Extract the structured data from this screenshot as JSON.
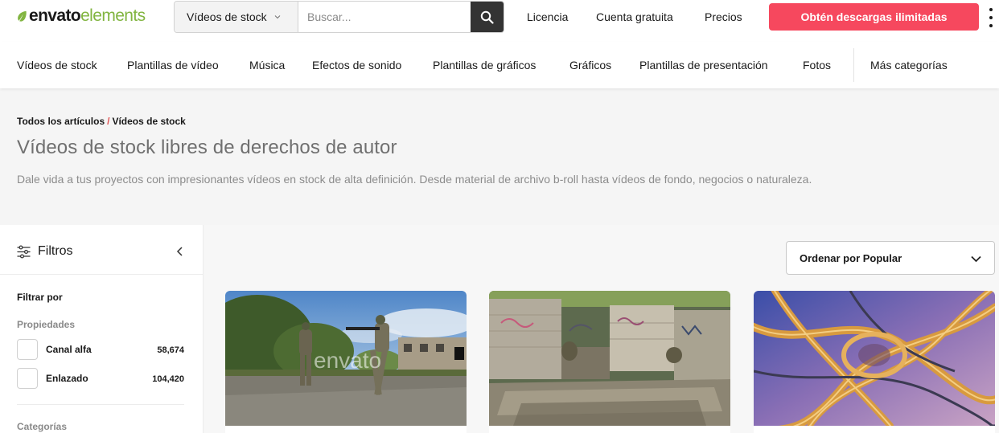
{
  "header": {
    "logo": {
      "part1": "envato",
      "part2": "elements",
      "icon": "leaf-icon"
    },
    "search": {
      "category": "Vídeos de stock",
      "placeholder": "Buscar...",
      "value": ""
    },
    "nav": [
      "Licencia",
      "Cuenta gratuita",
      "Precios"
    ],
    "cta": "Obtén descargas ilimitadas",
    "accent_color": "#f6485e",
    "brand_green": "#82b541"
  },
  "categories": {
    "items": [
      "Vídeos de stock",
      "Plantillas de vídeo",
      "Música",
      "Efectos de sonido",
      "Plantillas de gráficos",
      "Gráficos",
      "Plantillas de presentación",
      "Fotos"
    ],
    "more": "Más categorías"
  },
  "hero": {
    "breadcrumb": [
      "Todos los artículos",
      "Vídeos de stock"
    ],
    "breadcrumb_sep": "/",
    "title": "Vídeos de stock libres de derechos de autor",
    "description": "Dale vida a tus proyectos con impresionantes vídeos en stock de alta definición. Desde material de archivo b-roll hasta vídeos de fondo, negocios o naturaleza."
  },
  "sidebar": {
    "title": "Filtros",
    "filter_by": "Filtrar por",
    "properties_label": "Propiedades",
    "properties": [
      {
        "label": "Canal alfa",
        "count": "58,674",
        "checked": false
      },
      {
        "label": "Enlazado",
        "count": "104,420",
        "checked": false
      }
    ],
    "categories_label": "Categorías"
  },
  "sort": {
    "label": "Ordenar por Popular"
  },
  "cards": [
    {
      "name": "soldiers-video",
      "watermark": "envato"
    },
    {
      "name": "ruins-graffiti-video"
    },
    {
      "name": "highway-interchange-video"
    }
  ]
}
